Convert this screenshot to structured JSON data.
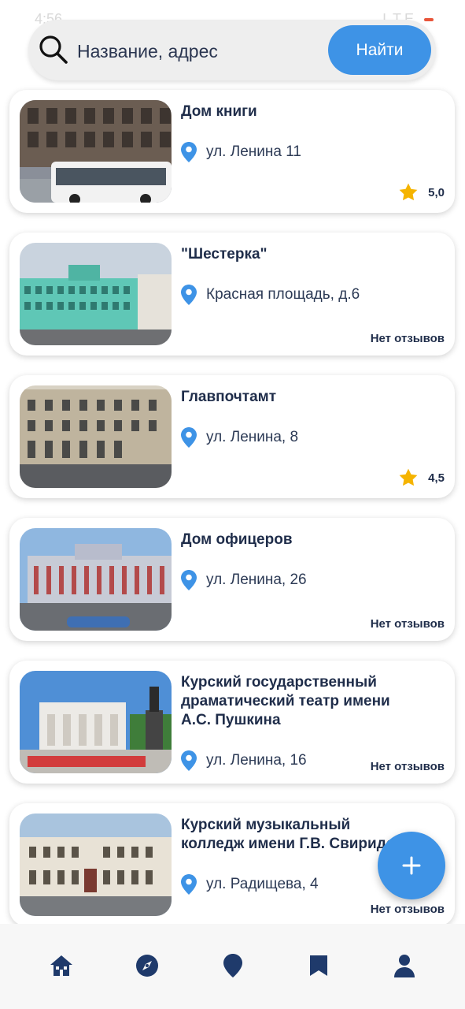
{
  "status_bar": {
    "time": "4:56",
    "indicators": "LTE"
  },
  "search": {
    "placeholder": "Название, адрес",
    "button_label": "Найти"
  },
  "places": [
    {
      "title": "Дом книги",
      "address": "ул. Ленина 11",
      "rating": "5,0",
      "reviews": null
    },
    {
      "title": "\"Шестерка\"",
      "address": "Красная площадь, д.6",
      "rating": null,
      "reviews": "Нет отзывов"
    },
    {
      "title": "Главпочтамт",
      "address": "ул. Ленина, 8",
      "rating": "4,5",
      "reviews": null
    },
    {
      "title": "Дом офицеров",
      "address": "ул. Ленина, 26",
      "rating": null,
      "reviews": "Нет отзывов"
    },
    {
      "title": "Курский государственный драматический театр имени А.С. Пушкина",
      "address": "ул. Ленина, 16",
      "rating": null,
      "reviews": "Нет отзывов"
    },
    {
      "title": "Курский музыкальный колледж имени Г.В. Свиридова",
      "address": "ул. Радищева, 4",
      "rating": null,
      "reviews": "Нет отзывов"
    }
  ],
  "nav": {
    "items": [
      {
        "icon": "home-icon"
      },
      {
        "icon": "compass-icon"
      },
      {
        "icon": "map-pin-icon"
      },
      {
        "icon": "bookmark-icon"
      },
      {
        "icon": "profile-icon"
      }
    ]
  },
  "colors": {
    "accent": "#3e93e6",
    "text_dark": "#1f2d4a",
    "nav_icon": "#1f3a6b",
    "star": "#f5b400",
    "pin": "#3e93e6"
  }
}
